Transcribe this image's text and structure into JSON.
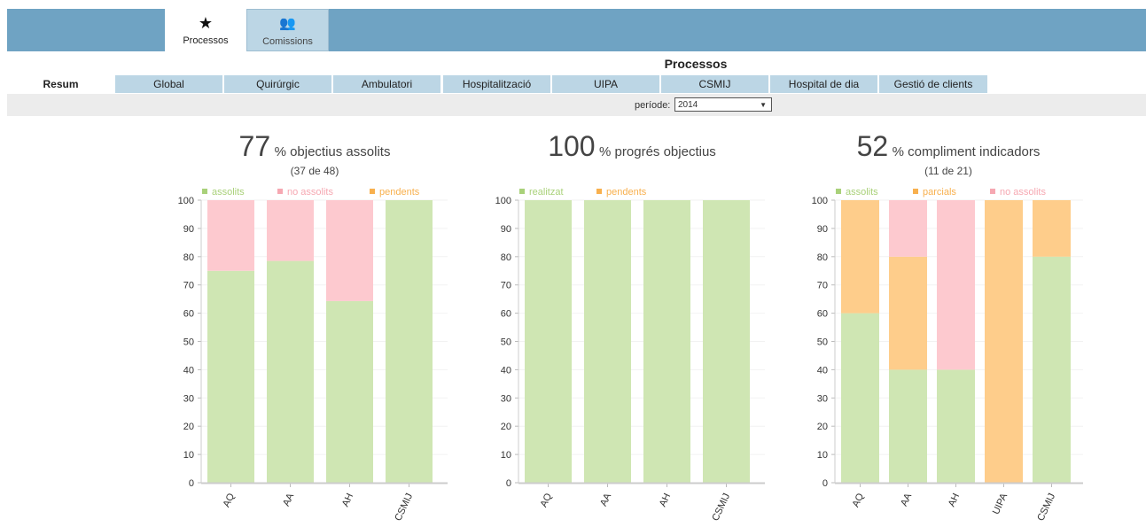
{
  "top_tabs": [
    {
      "label": "Processos",
      "icon": "star-icon",
      "glyph": "★",
      "active": true
    },
    {
      "label": "Comissions",
      "icon": "users-icon",
      "glyph": "👥",
      "active": false
    }
  ],
  "page_title": "Processos",
  "sub_tabs": [
    "Resum",
    "Global",
    "Quirúrgic",
    "Ambulatori",
    "Hospitalització",
    "UIPA",
    "CSMIJ",
    "Hospital de dia",
    "Gestió de clients"
  ],
  "period": {
    "label": "període:",
    "value": "2014",
    "arrow": "▼"
  },
  "colors": {
    "green": "#cfe6b3",
    "pink": "#fdc9cf",
    "orange": "#fecd8b",
    "green_text": "#a9d17a",
    "pink_text": "#f6a8b2",
    "orange_text": "#f8b04e"
  },
  "charts": [
    {
      "big": "77",
      "rest": "% objectius assolits",
      "sub": "(37 de 48)",
      "legend": [
        {
          "label": "assolits",
          "color": "green"
        },
        {
          "label": "no assolits",
          "color": "pink"
        },
        {
          "label": "pendents",
          "color": "orange"
        }
      ]
    },
    {
      "big": "100",
      "rest": "% progrés objectius",
      "sub": "",
      "legend": [
        {
          "label": "realitzat",
          "color": "green"
        },
        {
          "label": "pendents",
          "color": "orange"
        }
      ]
    },
    {
      "big": "52",
      "rest": "% compliment indicadors",
      "sub": "(11 de 21)",
      "legend": [
        {
          "label": "assolits",
          "color": "green"
        },
        {
          "label": "parcials",
          "color": "orange"
        },
        {
          "label": "no assolits",
          "color": "pink"
        }
      ]
    }
  ],
  "chart_data": [
    {
      "type": "bar",
      "stacked": true,
      "categories": [
        "AQ",
        "AA",
        "AH",
        "CSMIJ"
      ],
      "series": [
        {
          "name": "assolits",
          "color": "green",
          "values": [
            75,
            78.5,
            64.3,
            100
          ]
        },
        {
          "name": "no assolits",
          "color": "pink",
          "values": [
            25,
            21.5,
            35.7,
            0
          ]
        },
        {
          "name": "pendents",
          "color": "orange",
          "values": [
            0,
            0,
            0,
            0
          ]
        }
      ],
      "ylim": [
        0,
        100
      ],
      "yticks": [
        0,
        10,
        20,
        30,
        40,
        50,
        60,
        70,
        80,
        90,
        100
      ],
      "legend": "top"
    },
    {
      "type": "bar",
      "stacked": true,
      "categories": [
        "AQ",
        "AA",
        "AH",
        "CSMIJ"
      ],
      "series": [
        {
          "name": "realitzat",
          "color": "green",
          "values": [
            100,
            100,
            100,
            100
          ]
        },
        {
          "name": "pendents",
          "color": "orange",
          "values": [
            0,
            0,
            0,
            0
          ]
        }
      ],
      "ylim": [
        0,
        100
      ],
      "yticks": [
        0,
        10,
        20,
        30,
        40,
        50,
        60,
        70,
        80,
        90,
        100
      ],
      "legend": "top"
    },
    {
      "type": "bar",
      "stacked": true,
      "categories": [
        "AQ",
        "AA",
        "AH",
        "UIPA",
        "CSMIJ"
      ],
      "series": [
        {
          "name": "assolits",
          "color": "green",
          "values": [
            60,
            40,
            40,
            0,
            80
          ]
        },
        {
          "name": "parcials",
          "color": "orange",
          "values": [
            40,
            40,
            0,
            100,
            20
          ]
        },
        {
          "name": "no assolits",
          "color": "pink",
          "values": [
            0,
            20,
            60,
            0,
            0
          ]
        }
      ],
      "ylim": [
        0,
        100
      ],
      "yticks": [
        0,
        10,
        20,
        30,
        40,
        50,
        60,
        70,
        80,
        90,
        100
      ],
      "legend": "top"
    }
  ]
}
